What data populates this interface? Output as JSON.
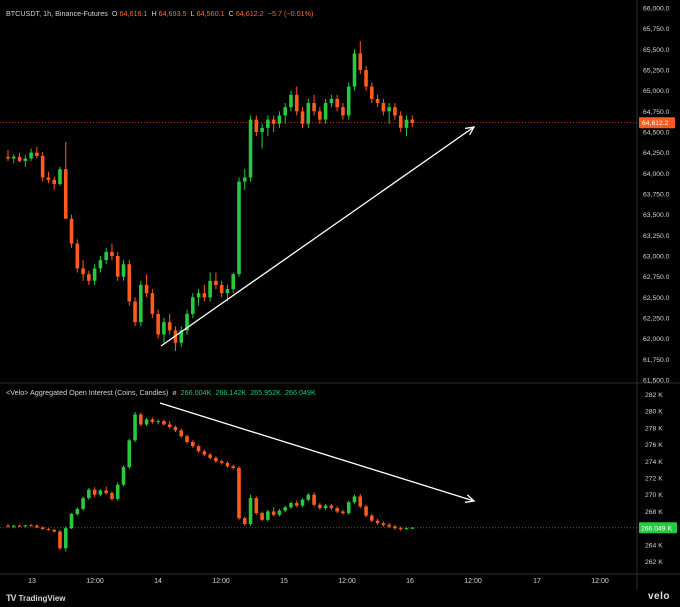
{
  "price_legend": {
    "symbol": "BTCUSDT, 1h, Binance-Futures",
    "o_label": "O",
    "o_value": "64,616.1",
    "h_label": "H",
    "h_value": "64,693.5",
    "l_label": "L",
    "l_value": "64,560.1",
    "c_label": "C",
    "c_value": "64,612.2",
    "change": "−5.7 (−0.01%)"
  },
  "oi_legend": {
    "title": "<Velo> Aggregated Open Interest (Coins, Candles)",
    "eye": "ø",
    "values": [
      "266.004K",
      "266.142K",
      "265.952K",
      "266.049K"
    ]
  },
  "branding": {
    "tradingview": "TradingView",
    "velo": "velo"
  },
  "colors": {
    "background": "#000000",
    "up": "#26c940",
    "down": "#ff5a1f",
    "axis_text": "#d1d4dc",
    "grid": "#1e1e1e",
    "arrow": "#ffffff",
    "price_badge": "#ff5a1f",
    "oi_badge": "#26c940"
  },
  "chart_data": [
    {
      "type": "candlestick",
      "title": "BTCUSDT, 1h, Binance-Futures",
      "x_ticks": [
        "13",
        "12:00",
        "14",
        "12:00",
        "15",
        "12:00",
        "16",
        "12:00",
        "17",
        "12:00"
      ],
      "y_ticks": [
        "61,500.0",
        "61,750.0",
        "62,000.0",
        "62,250.0",
        "62,500.0",
        "62,750.0",
        "63,000.0",
        "63,250.0",
        "63,500.0",
        "63,750.0",
        "64,000.0",
        "64,250.0",
        "64,500.0",
        "64,750.0",
        "65,000.0",
        "65,250.0",
        "65,500.0",
        "65,750.0",
        "66,000.0"
      ],
      "ylim": [
        61500,
        66000
      ],
      "last_price_label": "64,612.2",
      "last_price": 64612.2,
      "candles": [
        [
          64200,
          64280,
          64150,
          64180
        ],
        [
          64180,
          64230,
          64120,
          64200
        ],
        [
          64200,
          64250,
          64130,
          64150
        ],
        [
          64150,
          64220,
          64080,
          64180
        ],
        [
          64180,
          64300,
          64150,
          64250
        ],
        [
          64250,
          64320,
          64180,
          64210
        ],
        [
          64210,
          64260,
          63900,
          63950
        ],
        [
          63950,
          64020,
          63880,
          63920
        ],
        [
          63920,
          63960,
          63800,
          63870
        ],
        [
          63870,
          64080,
          63850,
          64050
        ],
        [
          64050,
          64380,
          63700,
          63450
        ],
        [
          63450,
          63500,
          63100,
          63150
        ],
        [
          63150,
          63200,
          62800,
          62850
        ],
        [
          62850,
          62950,
          62700,
          62780
        ],
        [
          62780,
          62820,
          62650,
          62700
        ],
        [
          62700,
          62900,
          62650,
          62850
        ],
        [
          62850,
          63000,
          62800,
          62950
        ],
        [
          62950,
          63100,
          62900,
          63050
        ],
        [
          63050,
          63150,
          62950,
          63000
        ],
        [
          63000,
          63050,
          62700,
          62750
        ],
        [
          62750,
          62950,
          62700,
          62900
        ],
        [
          62900,
          62950,
          62400,
          62450
        ],
        [
          62450,
          62500,
          62150,
          62200
        ],
        [
          62200,
          62700,
          62150,
          62650
        ],
        [
          62650,
          62780,
          62500,
          62550
        ],
        [
          62550,
          62600,
          62250,
          62300
        ],
        [
          62300,
          62350,
          62000,
          62050
        ],
        [
          62050,
          62250,
          61950,
          62200
        ],
        [
          62200,
          62300,
          62050,
          62100
        ],
        [
          62100,
          62150,
          61850,
          61950
        ],
        [
          61950,
          62150,
          61900,
          62100
        ],
        [
          62100,
          62350,
          62050,
          62300
        ],
        [
          62300,
          62550,
          62250,
          62500
        ],
        [
          62500,
          62600,
          62400,
          62550
        ],
        [
          62550,
          62650,
          62450,
          62500
        ],
        [
          62500,
          62800,
          62450,
          62700
        ],
        [
          62700,
          62800,
          62600,
          62650
        ],
        [
          62650,
          62700,
          62500,
          62550
        ],
        [
          62550,
          62650,
          62450,
          62600
        ],
        [
          62600,
          62800,
          62550,
          62780
        ],
        [
          62780,
          63950,
          62750,
          63900
        ],
        [
          63900,
          64050,
          63800,
          63950
        ],
        [
          63950,
          64700,
          63900,
          64650
        ],
        [
          64650,
          64700,
          64450,
          64500
        ],
        [
          64500,
          64600,
          64300,
          64550
        ],
        [
          64550,
          64700,
          64450,
          64650
        ],
        [
          64650,
          64700,
          64500,
          64600
        ],
        [
          64600,
          64750,
          64550,
          64700
        ],
        [
          64700,
          64850,
          64600,
          64800
        ],
        [
          64800,
          65000,
          64750,
          64950
        ],
        [
          64950,
          65050,
          64700,
          64750
        ],
        [
          64750,
          64800,
          64550,
          64600
        ],
        [
          64600,
          64900,
          64550,
          64850
        ],
        [
          64850,
          64950,
          64700,
          64750
        ],
        [
          64750,
          64800,
          64600,
          64650
        ],
        [
          64650,
          64900,
          64600,
          64850
        ],
        [
          64850,
          64950,
          64800,
          64900
        ],
        [
          64900,
          64950,
          64750,
          64800
        ],
        [
          64800,
          64850,
          64650,
          64700
        ],
        [
          64700,
          65100,
          64650,
          65050
        ],
        [
          65050,
          65500,
          65000,
          65450
        ],
        [
          65450,
          65600,
          65200,
          65250
        ],
        [
          65250,
          65300,
          65000,
          65050
        ],
        [
          65050,
          65100,
          64850,
          64900
        ],
        [
          64900,
          64950,
          64800,
          64850
        ],
        [
          64850,
          64900,
          64700,
          64750
        ],
        [
          64750,
          64850,
          64600,
          64800
        ],
        [
          64800,
          64850,
          64650,
          64700
        ],
        [
          64700,
          64750,
          64500,
          64550
        ],
        [
          64550,
          64700,
          64450,
          64650
        ],
        [
          64650,
          64700,
          64560,
          64612
        ]
      ],
      "annotation": "trend arrow (up)"
    },
    {
      "type": "candlestick",
      "title": "<Velo> Aggregated Open Interest (Coins, Candles)",
      "y_ticks": [
        "262 K",
        "264 K",
        "266 K",
        "268 K",
        "270 K",
        "272 K",
        "274 K",
        "276 K",
        "278 K",
        "280 K",
        "282 K"
      ],
      "ylim": [
        261000,
        283000
      ],
      "last_value_label": "266.049 K",
      "last_value": 266049,
      "candles": [
        [
          266300,
          266500,
          266100,
          266200
        ],
        [
          266200,
          266400,
          266000,
          266300
        ],
        [
          266300,
          266450,
          266150,
          266250
        ],
        [
          266250,
          266400,
          266100,
          266350
        ],
        [
          266350,
          266500,
          266200,
          266300
        ],
        [
          266300,
          266450,
          266000,
          266100
        ],
        [
          266100,
          266200,
          265800,
          265900
        ],
        [
          265900,
          266000,
          265700,
          265800
        ],
        [
          265800,
          265900,
          265500,
          265600
        ],
        [
          265600,
          265800,
          263400,
          263600
        ],
        [
          263600,
          266200,
          263200,
          266000
        ],
        [
          266000,
          267800,
          265900,
          267700
        ],
        [
          267700,
          268500,
          267500,
          268300
        ],
        [
          268300,
          269800,
          268100,
          269600
        ],
        [
          269600,
          270800,
          269400,
          270600
        ],
        [
          270600,
          270900,
          269700,
          270000
        ],
        [
          270000,
          270700,
          269800,
          270500
        ],
        [
          270500,
          271000,
          270000,
          270200
        ],
        [
          270200,
          270400,
          269300,
          269500
        ],
        [
          269500,
          271500,
          269300,
          271200
        ],
        [
          271200,
          273500,
          271000,
          273300
        ],
        [
          273300,
          276700,
          273100,
          276500
        ],
        [
          276500,
          279900,
          276300,
          279600
        ],
        [
          279600,
          279800,
          278200,
          278400
        ],
        [
          278400,
          279200,
          278200,
          279000
        ],
        [
          279000,
          279200,
          278500,
          278700
        ],
        [
          278700,
          279000,
          278400,
          278800
        ],
        [
          278800,
          279000,
          278300,
          278400
        ],
        [
          278400,
          278800,
          277900,
          278100
        ],
        [
          278100,
          278300,
          277500,
          277700
        ],
        [
          277700,
          277900,
          276800,
          277000
        ],
        [
          277000,
          277200,
          276100,
          276300
        ],
        [
          276300,
          276500,
          275600,
          275800
        ],
        [
          275800,
          276000,
          275000,
          275200
        ],
        [
          275200,
          275400,
          274600,
          274800
        ],
        [
          274800,
          275000,
          274200,
          274400
        ],
        [
          274400,
          274600,
          273800,
          274000
        ],
        [
          274000,
          274200,
          273600,
          273800
        ],
        [
          273800,
          274000,
          273200,
          273400
        ],
        [
          273400,
          273600,
          273000,
          273200
        ],
        [
          273200,
          273400,
          267000,
          267200
        ],
        [
          267200,
          267400,
          266300,
          266500
        ],
        [
          266500,
          270000,
          266300,
          269600
        ],
        [
          269600,
          269800,
          267600,
          267800
        ],
        [
          267800,
          268000,
          266800,
          267000
        ],
        [
          267000,
          268200,
          266800,
          268000
        ],
        [
          268000,
          268500,
          267400,
          267600
        ],
        [
          267600,
          268300,
          267400,
          268100
        ],
        [
          268100,
          268700,
          267900,
          268500
        ],
        [
          268500,
          269200,
          268300,
          269000
        ],
        [
          269000,
          269300,
          268500,
          268700
        ],
        [
          268700,
          269600,
          268500,
          269400
        ],
        [
          269400,
          270200,
          269200,
          270000
        ],
        [
          270000,
          270300,
          268600,
          268800
        ],
        [
          268800,
          269000,
          268200,
          268400
        ],
        [
          268400,
          268900,
          268200,
          268700
        ],
        [
          268700,
          268900,
          268200,
          268400
        ],
        [
          268400,
          268600,
          267800,
          268000
        ],
        [
          268000,
          268200,
          267600,
          267800
        ],
        [
          267800,
          269300,
          267600,
          269100
        ],
        [
          269100,
          270000,
          268900,
          269800
        ],
        [
          269800,
          270100,
          268400,
          268600
        ],
        [
          268600,
          268800,
          267300,
          267500
        ],
        [
          267500,
          267700,
          266700,
          266900
        ],
        [
          266900,
          267100,
          266400,
          266600
        ],
        [
          266600,
          266800,
          266200,
          266400
        ],
        [
          266400,
          266600,
          266000,
          266200
        ],
        [
          266200,
          266400,
          265800,
          266000
        ],
        [
          266000,
          266200,
          265700,
          265900
        ],
        [
          265900,
          266100,
          265800,
          266000
        ],
        [
          266004,
          266142,
          265952,
          266049
        ]
      ],
      "annotation": "trend arrow (down)"
    }
  ]
}
